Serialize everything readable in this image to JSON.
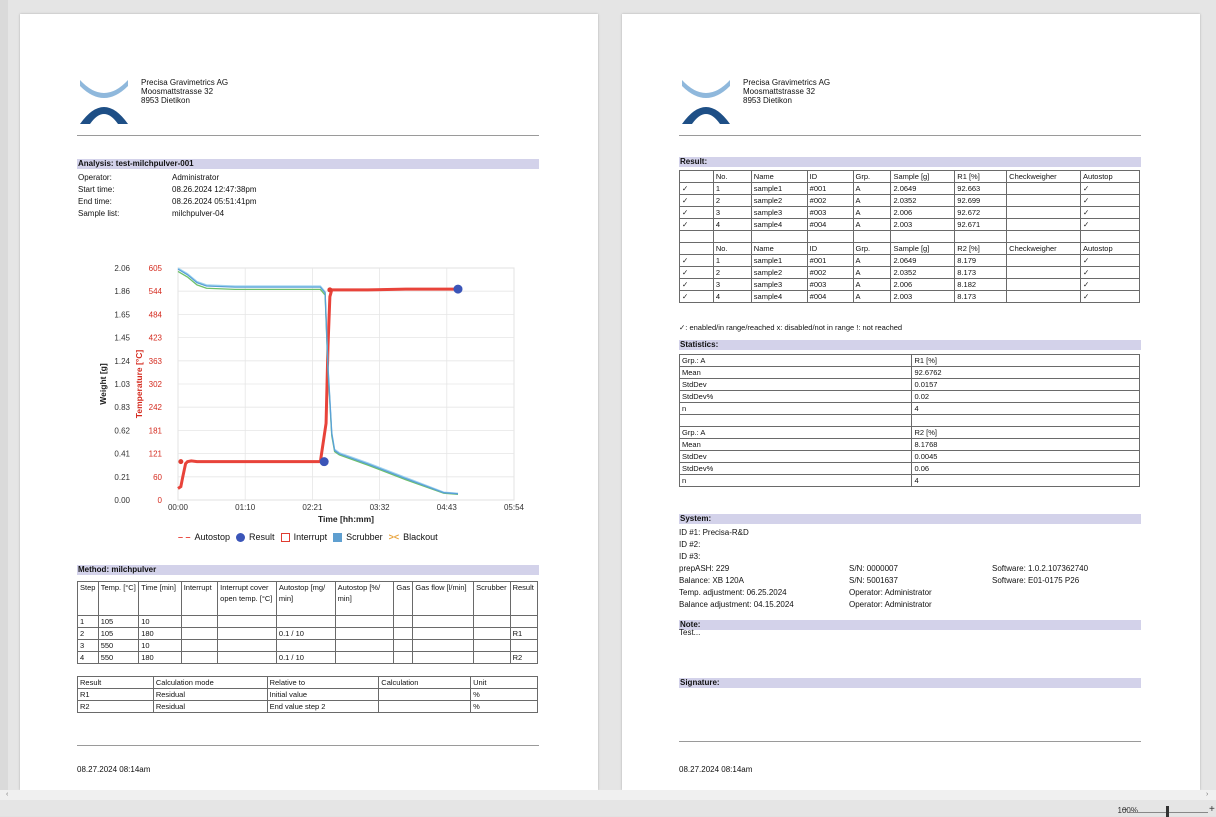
{
  "company": {
    "line1": "Precisa Gravimetrics AG",
    "line2": "Moosmattstrasse 32",
    "line3": "8953 Dietikon"
  },
  "analysis": {
    "title": "Analysis: test-milchpulver-001",
    "rows": [
      {
        "k": "Operator:",
        "v": "Administrator"
      },
      {
        "k": "Start time:",
        "v": "08.26.2024 12:47:38pm"
      },
      {
        "k": "End time:",
        "v": "08.26.2024 05:51:41pm"
      },
      {
        "k": "Sample list:",
        "v": "milchpulver-04"
      }
    ]
  },
  "chart_data": {
    "type": "line",
    "xlabel": "Time [hh:mm]",
    "ylabel": "Weight [g]",
    "y2label": "Temperature [°C]",
    "x_ticks": [
      "00:00",
      "01:10",
      "02:21",
      "03:32",
      "04:43",
      "05:54"
    ],
    "y_ticks": [
      "0.00",
      "0.21",
      "0.41",
      "0.62",
      "0.83",
      "1.03",
      "1.24",
      "1.45",
      "1.65",
      "1.86",
      "2.06"
    ],
    "y2_ticks": [
      "0",
      "60",
      "121",
      "181",
      "242",
      "302",
      "363",
      "423",
      "484",
      "544",
      "605"
    ],
    "xlim_min": [
      0,
      354
    ],
    "ylim": [
      0,
      2.06
    ],
    "y2lim": [
      0,
      605
    ],
    "series": [
      {
        "name": "temperature",
        "color": "#e8433a",
        "x": [
          0,
          3,
          5,
          8,
          10,
          14,
          20,
          40,
          80,
          120,
          150,
          156,
          158,
          160,
          162,
          165,
          170,
          200,
          240,
          280,
          295
        ],
        "y": [
          30,
          35,
          60,
          95,
          100,
          102,
          100,
          100,
          100,
          100,
          100,
          200,
          400,
          530,
          548,
          548,
          548,
          548,
          550,
          550,
          550
        ]
      },
      {
        "name": "weight1",
        "color": "#9fd3ef",
        "x": [
          0,
          10,
          20,
          30,
          60,
          100,
          150,
          155,
          158,
          162,
          165,
          170,
          200,
          240,
          280,
          295
        ],
        "y": [
          2.06,
          2.01,
          1.94,
          1.91,
          1.9,
          1.9,
          1.9,
          1.85,
          1.2,
          0.6,
          0.45,
          0.42,
          0.33,
          0.2,
          0.07,
          0.06
        ]
      },
      {
        "name": "weight2",
        "color": "#6dc06a",
        "x": [
          0,
          10,
          20,
          30,
          60,
          100,
          150,
          155,
          158,
          162,
          165,
          170,
          200,
          240,
          280,
          295
        ],
        "y": [
          2.03,
          1.98,
          1.91,
          1.88,
          1.87,
          1.87,
          1.87,
          1.82,
          1.15,
          0.57,
          0.43,
          0.4,
          0.31,
          0.18,
          0.06,
          0.05
        ]
      },
      {
        "name": "weight3",
        "color": "#5aa0d8",
        "x": [
          0,
          10,
          20,
          30,
          60,
          100,
          150,
          155,
          158,
          162,
          165,
          170,
          200,
          240,
          280,
          295
        ],
        "y": [
          2.05,
          2.0,
          1.93,
          1.9,
          1.89,
          1.89,
          1.89,
          1.84,
          1.18,
          0.59,
          0.44,
          0.41,
          0.32,
          0.19,
          0.065,
          0.055
        ]
      }
    ],
    "markers": [
      {
        "x": 3,
        "y": 100,
        "color": "#e03c31",
        "r": 2.5
      },
      {
        "x": 154,
        "y": 100,
        "color": "#3b55b8",
        "r": 4.5
      },
      {
        "x": 160,
        "y": 548,
        "color": "#e03c31",
        "r": 2.5
      },
      {
        "x": 295,
        "y": 550,
        "color": "#3b55b8",
        "r": 4.5
      }
    ],
    "legend": [
      "Autostop",
      "Result",
      "Interrupt",
      "Scrubber",
      "Blackout"
    ]
  },
  "method": {
    "title": "Method: milchpulver",
    "header": [
      "Step",
      "Temp. [°C]",
      "Time [min]",
      "Interrupt",
      "Interrupt cover open temp. [°C]",
      "Autostop [mg/ min]",
      "Autostop [%/ min]",
      "Gas",
      "Gas flow [l/min]",
      "Scrubber",
      "Result"
    ],
    "rows": [
      [
        "1",
        "105",
        "10",
        "",
        "",
        "",
        "",
        "",
        "",
        "",
        ""
      ],
      [
        "2",
        "105",
        "180",
        "",
        "",
        "0.1 / 10",
        "",
        "",
        "",
        "",
        "R1"
      ],
      [
        "3",
        "550",
        "10",
        "",
        "",
        "",
        "",
        "",
        "",
        "",
        ""
      ],
      [
        "4",
        "550",
        "180",
        "",
        "",
        "0.1 / 10",
        "",
        "",
        "",
        "",
        "R2"
      ]
    ],
    "calc_header": [
      "Result",
      "Calculation mode",
      "Relative to",
      "Calculation",
      "Unit"
    ],
    "calc_rows": [
      [
        "R1",
        "Residual",
        "Initial value",
        "",
        "%"
      ],
      [
        "R2",
        "Residual",
        "End value step 2",
        "",
        "%"
      ]
    ]
  },
  "footer_date": "08.27.2024 08:14am",
  "result": {
    "title": "Result:",
    "h1": [
      "",
      "No.",
      "Name",
      "ID",
      "Grp.",
      "Sample [g]",
      "R1 [%]",
      "Checkweigher",
      "Autostop"
    ],
    "r1": [
      [
        "✓",
        "1",
        "sample1",
        "#001",
        "A",
        "2.0649",
        "92.663",
        "",
        "✓"
      ],
      [
        "✓",
        "2",
        "sample2",
        "#002",
        "A",
        "2.0352",
        "92.699",
        "",
        "✓"
      ],
      [
        "✓",
        "3",
        "sample3",
        "#003",
        "A",
        "2.006",
        "92.672",
        "",
        "✓"
      ],
      [
        "✓",
        "4",
        "sample4",
        "#004",
        "A",
        "2.003",
        "92.671",
        "",
        "✓"
      ]
    ],
    "h2": [
      "",
      "No.",
      "Name",
      "ID",
      "Grp.",
      "Sample [g]",
      "R2 [%]",
      "Checkweigher",
      "Autostop"
    ],
    "r2": [
      [
        "✓",
        "1",
        "sample1",
        "#001",
        "A",
        "2.0649",
        "8.179",
        "",
        "✓"
      ],
      [
        "✓",
        "2",
        "sample2",
        "#002",
        "A",
        "2.0352",
        "8.173",
        "",
        "✓"
      ],
      [
        "✓",
        "3",
        "sample3",
        "#003",
        "A",
        "2.006",
        "8.182",
        "",
        "✓"
      ],
      [
        "✓",
        "4",
        "sample4",
        "#004",
        "A",
        "2.003",
        "8.173",
        "",
        "✓"
      ]
    ],
    "note": "✓: enabled/in range/reached    x: disabled/not in range    !: not reached"
  },
  "statistics": {
    "title": "Statistics:",
    "rows": [
      [
        "Grp.: A",
        "R1 [%]"
      ],
      [
        "Mean",
        "92.6762"
      ],
      [
        "StdDev",
        "0.0157"
      ],
      [
        "StdDev%",
        "0.02"
      ],
      [
        "n",
        "4"
      ],
      [
        "",
        ""
      ],
      [
        "Grp.: A",
        "R2 [%]"
      ],
      [
        "Mean",
        "8.1768"
      ],
      [
        "StdDev",
        "0.0045"
      ],
      [
        "StdDev%",
        "0.06"
      ],
      [
        "n",
        "4"
      ]
    ]
  },
  "system": {
    "title": "System:",
    "ids": [
      "ID #1: Precisa-R&D",
      "ID #2:",
      "ID #3:"
    ],
    "c1": [
      "prepASH: 229",
      "Balance: XB 120A",
      "Temp. adjustment: 06.25.2024",
      "Balance adjustment: 04.15.2024"
    ],
    "c2": [
      "S/N: 0000007",
      "S/N: 5001637",
      "Operator: Administrator",
      "Operator: Administrator"
    ],
    "c3": [
      "Software: 1.0.2.107362740",
      "Software: E01-0175 P26"
    ]
  },
  "note": {
    "title": "Note:",
    "text": "Test..."
  },
  "signature": {
    "title": "Signature:"
  },
  "zoom": "100%"
}
